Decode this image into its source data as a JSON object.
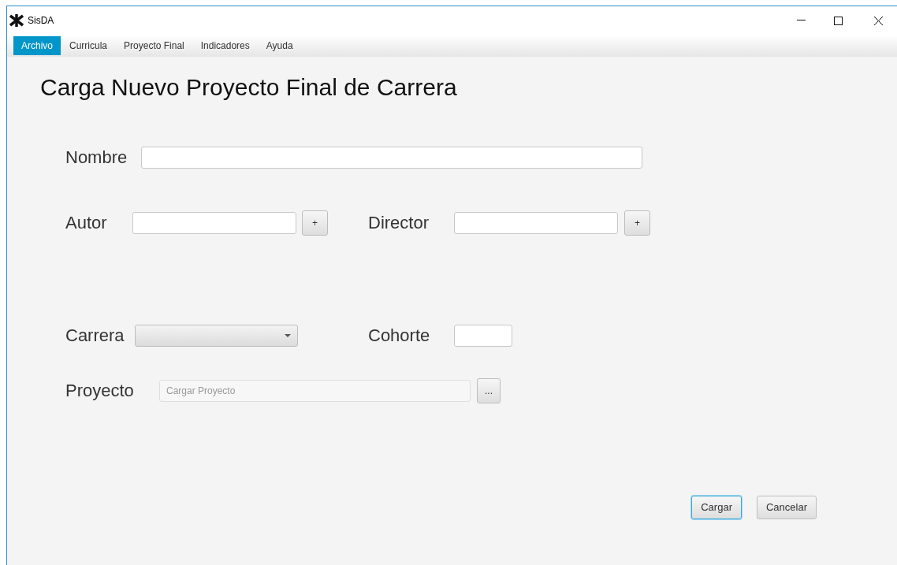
{
  "window": {
    "title": "SisDA"
  },
  "menu": [
    {
      "label": "Archivo",
      "selected": true
    },
    {
      "label": "Curricula",
      "selected": false
    },
    {
      "label": "Proyecto Final",
      "selected": false
    },
    {
      "label": "Indicadores",
      "selected": false
    },
    {
      "label": "Ayuda",
      "selected": false
    }
  ],
  "heading": "Carga Nuevo Proyecto Final de Carrera",
  "form": {
    "nombre": {
      "label": "Nombre"
    },
    "autor": {
      "label": "Autor",
      "add": "+"
    },
    "director": {
      "label": "Director",
      "add": "+"
    },
    "carrera": {
      "label": "Carrera"
    },
    "cohorte": {
      "label": "Cohorte"
    },
    "proyecto": {
      "label": "Proyecto",
      "placeholder": "Cargar Proyecto",
      "browse": "..."
    }
  },
  "buttons": [
    {
      "label": "Cargar",
      "focused": true
    },
    {
      "label": "Cancelar",
      "focused": false
    }
  ]
}
